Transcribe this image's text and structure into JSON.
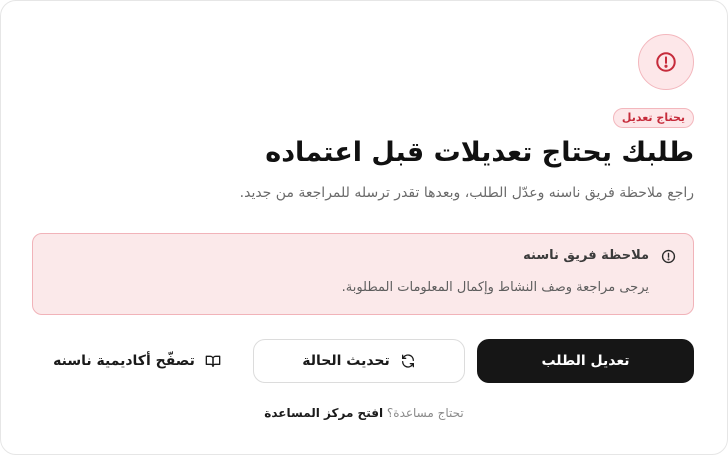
{
  "status": {
    "icon": "alert-circle-icon",
    "badge": "يحتاج تعديل",
    "accent_color": "#c62b3b"
  },
  "header": {
    "title": "طلبك يحتاج تعديلات قبل اعتماده",
    "subtitle": "راجع ملاحظة فريق ناسنه وعدّل الطلب، وبعدها تقدر ترسله للمراجعة من جديد."
  },
  "note": {
    "icon": "alert-circle-icon",
    "title": "ملاحظة فريق ناسنه",
    "body": "يرجى مراجعة وصف النشاط وإكمال المعلومات المطلوبة."
  },
  "actions": {
    "edit_label": "تعديل الطلب",
    "refresh_label": "تحديث الحالة",
    "refresh_icon": "refresh-icon",
    "academy_label": "تصفّح أكاديمية ناسنه",
    "academy_icon": "book-open-icon"
  },
  "footer": {
    "prompt": "تحتاج مساعدة؟",
    "link": "افتح مركز المساعدة"
  }
}
